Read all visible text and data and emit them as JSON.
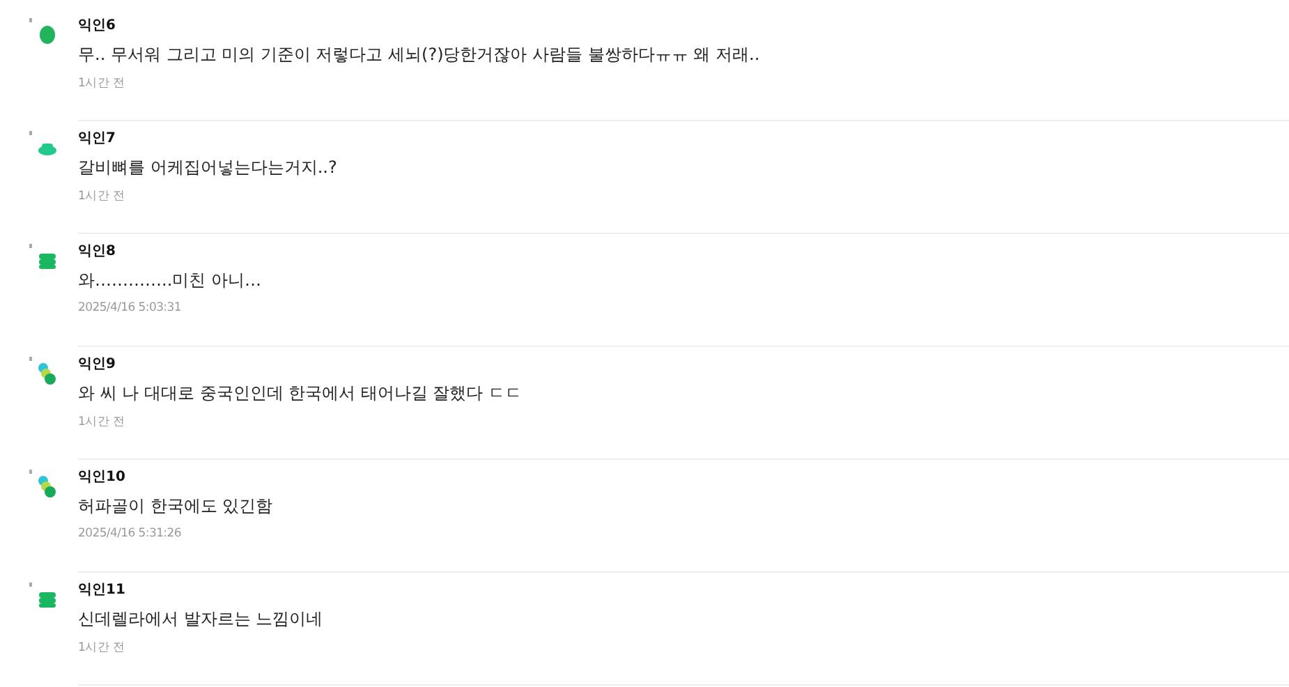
{
  "comments": [
    {
      "author": "익인6",
      "avatar": {
        "kind": "blob"
      },
      "text": "무.. 무서워 그리고 미의 기준이 저렇다고 세뇌(?)당한거잖아 사람들 불쌍하다ㅠㅠ 왜 저래..",
      "time": "1시간 전"
    },
    {
      "author": "익인7",
      "avatar": {
        "kind": "cap"
      },
      "text": "갈비뼈를 어케집어넣는다는거지..?",
      "time": "1시간 전"
    },
    {
      "author": "익인8",
      "avatar": {
        "kind": "stack"
      },
      "text": "와…………..미친 아니…",
      "time": "2025/4/16 5:03:31"
    },
    {
      "author": "익인9",
      "avatar": {
        "kind": "dots"
      },
      "text": "와 씨 나 대대로 중국인인데 한국에서 태어나길 잘했다 ㄷㄷ",
      "time": "1시간 전"
    },
    {
      "author": "익인10",
      "avatar": {
        "kind": "dots"
      },
      "text": "허파골이 한국에도 있긴함",
      "time": "2025/4/16 5:31:26"
    },
    {
      "author": "익인11",
      "avatar": {
        "kind": "stack"
      },
      "text": "신데렐라에서 발자르는 느낌이네",
      "time": "1시간 전"
    }
  ]
}
